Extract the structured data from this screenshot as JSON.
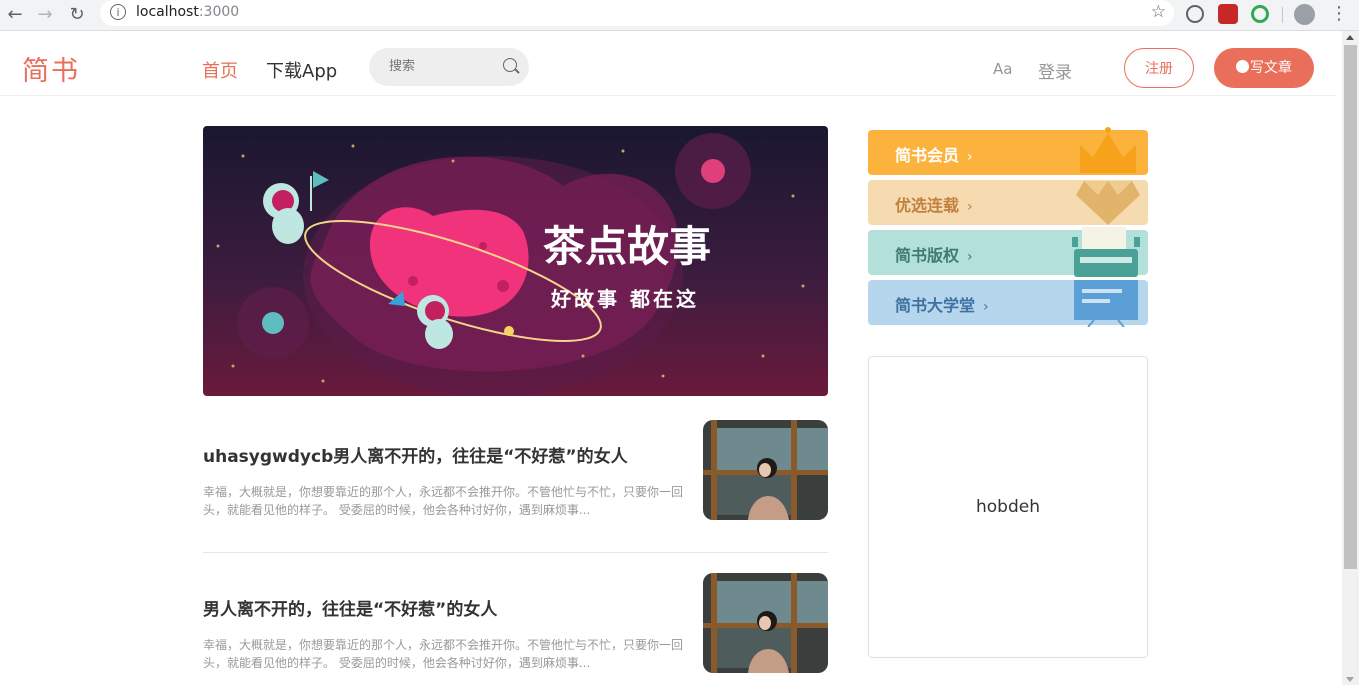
{
  "browser": {
    "url_host": "localhost",
    "url_port": ":3000"
  },
  "header": {
    "logo": "简书",
    "nav_home": "首页",
    "nav_app": "下载App",
    "search_placeholder": "搜索",
    "font_toggle": "Aa",
    "login": "登录",
    "register": "注册",
    "write": "写文章",
    "accent_color": "#ea6f5a"
  },
  "banner": {
    "title": "茶点故事",
    "subtitle": "好故事 都在这"
  },
  "articles": [
    {
      "title": "uhasygwdycb男人离不开的，往往是“不好惹”的女人",
      "abstract": "幸福，大概就是，你想要靠近的那个人，永远都不会推开你。不管他忙与不忙，只要你一回头，就能看见他的样子。 受委屈的时候，他会各种讨好你，遇到麻烦事..."
    },
    {
      "title": "男人离不开的，往往是“不好惹”的女人",
      "abstract": "幸福，大概就是，你想要靠近的那个人，永远都不会推开你。不管他忙与不忙，只要你一回头，就能看见他的样子。 受委屈的时候，他会各种讨好你，遇到麻烦事..."
    }
  ],
  "sidebar": {
    "boards": [
      {
        "label": "简书会员",
        "color": "#fcb33d"
      },
      {
        "label": "优选连载",
        "color": "#f6dbb0"
      },
      {
        "label": "简书版权",
        "color": "#b4e0da"
      },
      {
        "label": "简书大学堂",
        "color": "#b5d6ec"
      }
    ],
    "chevron": "›",
    "ad_text": "hobdeh"
  }
}
